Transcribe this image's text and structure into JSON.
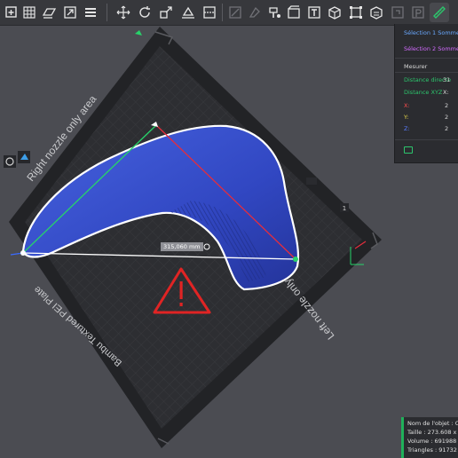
{
  "toolbar": {
    "icons": [
      "add-part-icon",
      "grid-arrange-icon",
      "plate-icon",
      "layers-icon",
      "move-icon",
      "rotate-icon",
      "scale-icon",
      "lay-flat-icon",
      "cut-icon",
      "support-paint-icon",
      "seam-paint-icon",
      "color-paint-icon",
      "text-icon",
      "assembly-icon",
      "mesh-boolean-icon",
      "measure-icon"
    ]
  },
  "plate": {
    "right_nozzle_label": "Right nozzle only area",
    "left_nozzle_label": "Left nozzle only area",
    "plate_name": "Bambu Textured PEI Plate",
    "plate_number": "1"
  },
  "measurement": {
    "distance_label": "315,060 mm"
  },
  "measure_panel": {
    "selection1_label": "Sélection 1",
    "selection1_value": "Somme",
    "selection2_label": "Sélection 2",
    "selection2_value": "Somme",
    "title": "Mesurer",
    "direct_distance_label": "Distance directe",
    "direct_distance_value": "31",
    "xyz_distance_label": "Distance XYZ",
    "xyz_distance_value": "X:",
    "x_label": "X:",
    "x_value": "2",
    "y_label": "Y:",
    "y_value": "2",
    "z_label": "Z:",
    "z_value": "2"
  },
  "info_panel": {
    "name": "Nom de l'objet : Co",
    "size": "Taille : 273.608 x 2",
    "volume": "Volume : 691988 m",
    "triangles": "Triangles : 91732"
  },
  "colors": {
    "model": "#3a4fc9",
    "selection_outline": "#ffffff",
    "measure_line_x": "#ff3b3b",
    "measure_line_y": "#27d36a",
    "measure_line_z": "#3b6bff",
    "warning": "#e02424",
    "plate_bed": "#2d2e32",
    "plate_border": "#222326"
  }
}
